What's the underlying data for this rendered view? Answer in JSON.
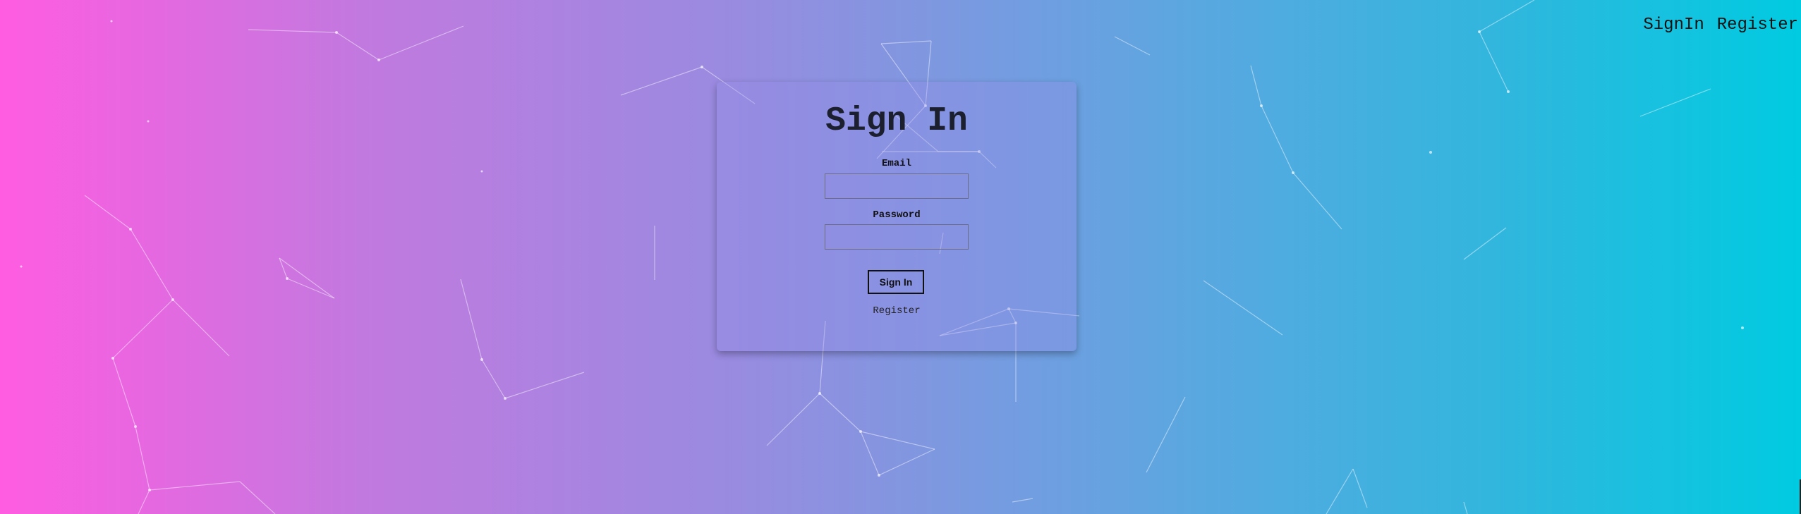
{
  "header": {
    "nav": [
      {
        "label": "SignIn"
      },
      {
        "label": "Register"
      }
    ]
  },
  "form": {
    "title": "Sign In",
    "email_label": "Email",
    "email_value": "",
    "password_label": "Password",
    "password_value": "",
    "submit_label": "Sign In",
    "register_link": "Register"
  },
  "colors": {
    "gradient_left": "#ff5ce1",
    "gradient_right": "#00cbe0",
    "text_dark": "#1b1f2e"
  },
  "background": {
    "pattern": "particle-network"
  }
}
